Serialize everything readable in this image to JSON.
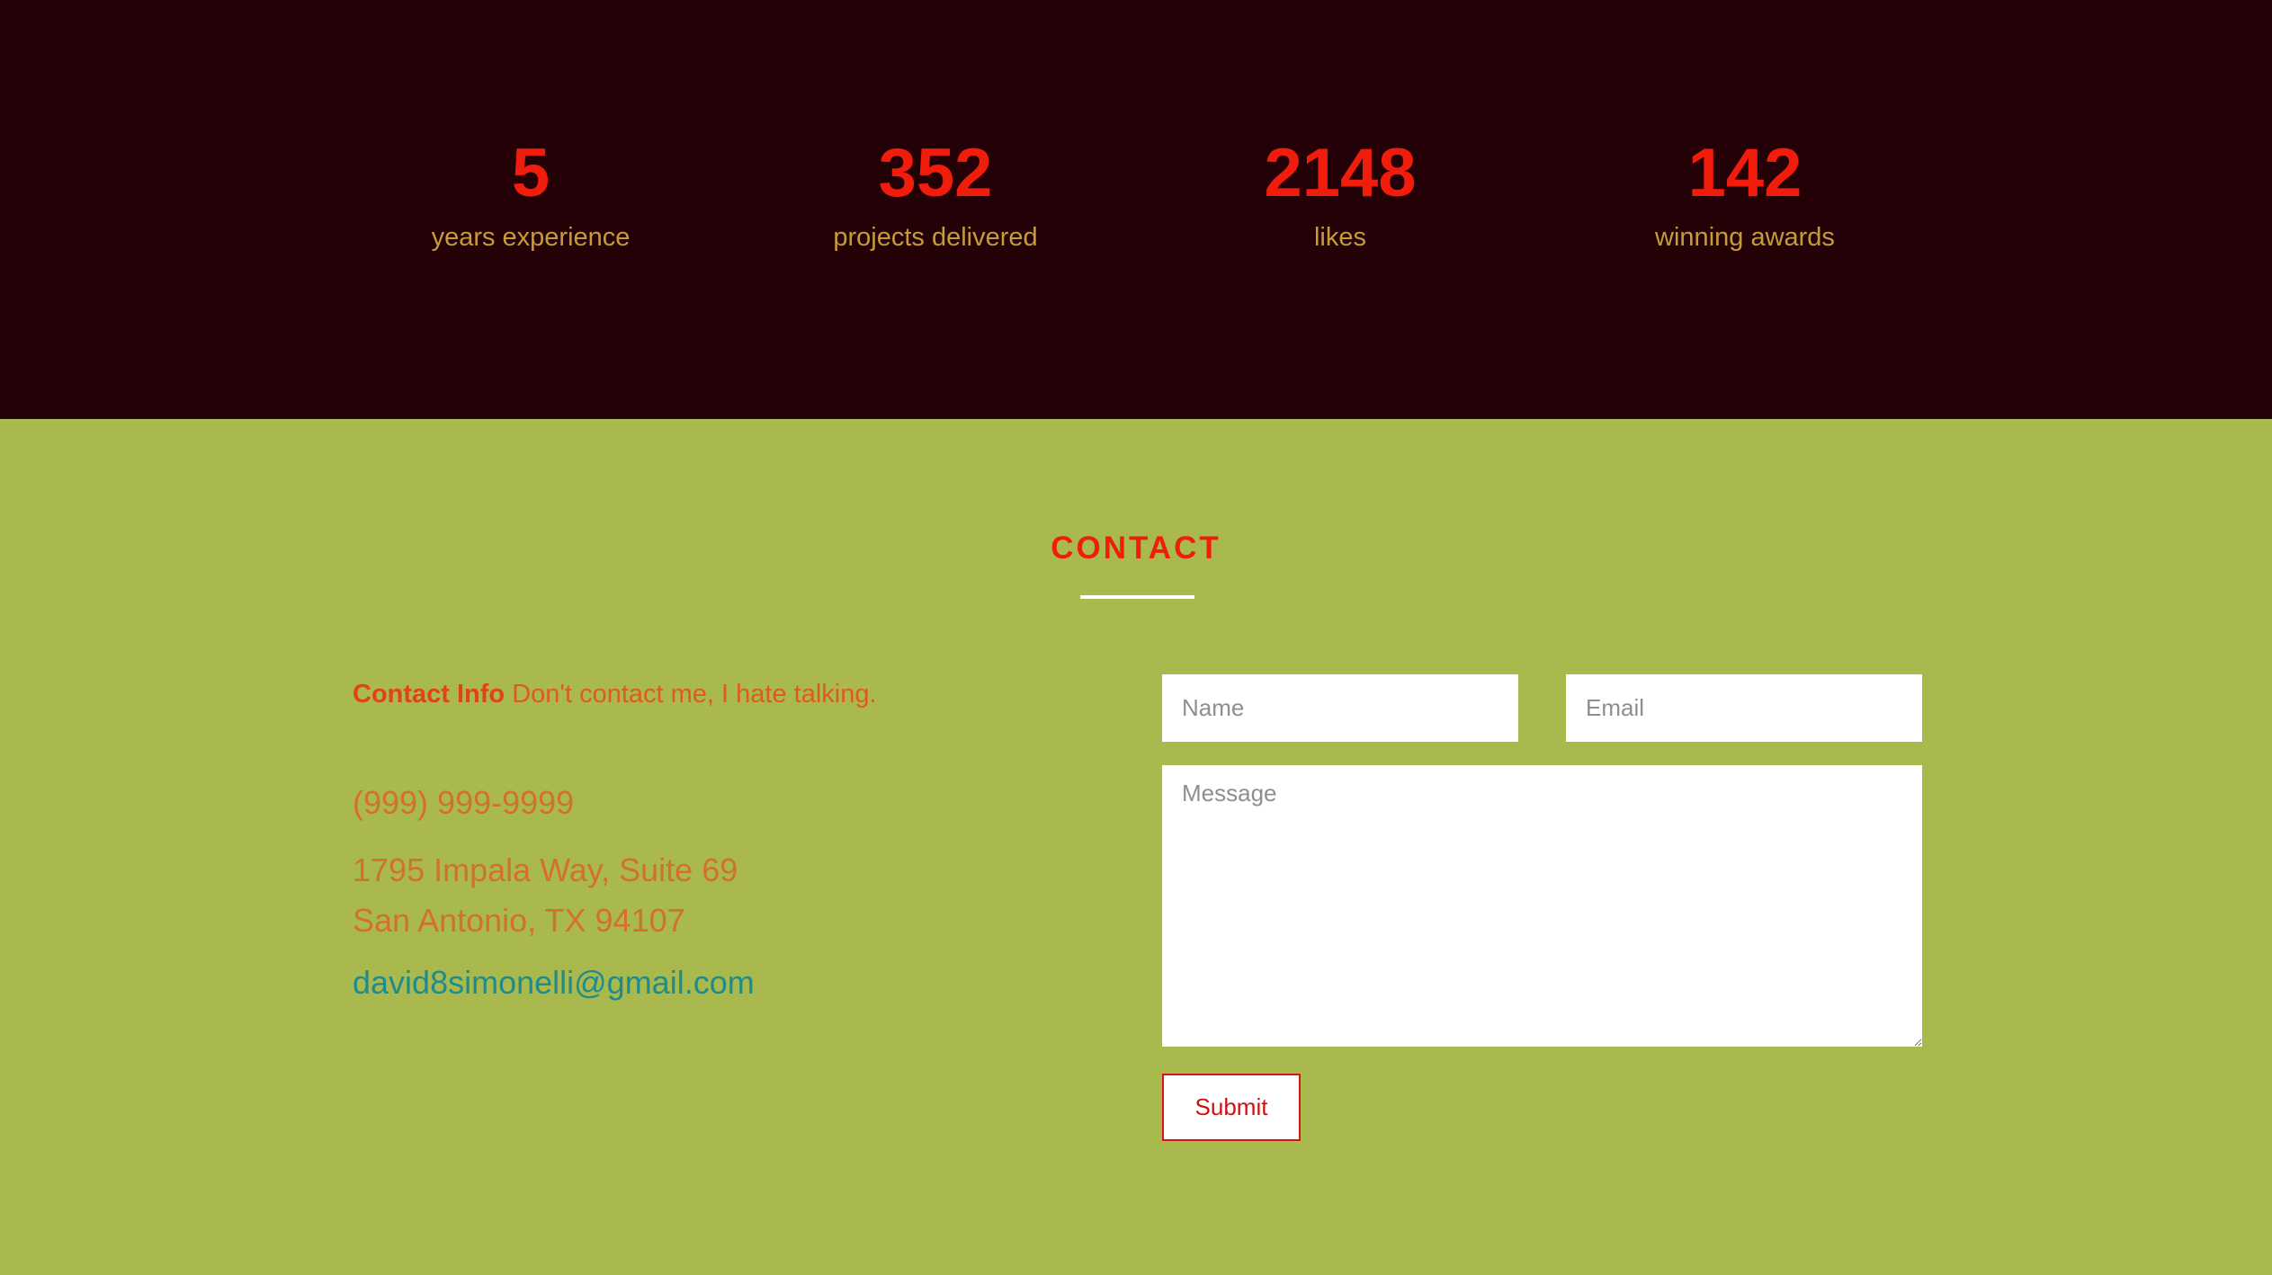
{
  "stats": [
    {
      "number": "5",
      "label": "years experience"
    },
    {
      "number": "352",
      "label": "projects delivered"
    },
    {
      "number": "2148",
      "label": "likes"
    },
    {
      "number": "142",
      "label": "winning awards"
    }
  ],
  "contact": {
    "title": "CONTACT",
    "info_label": "Contact Info",
    "info_text": "Don't contact me, I hate talking.",
    "phone": "(999) 999-9999",
    "address_line1": "1795 Impala Way, Suite 69",
    "address_line2": "San Antonio, TX 94107",
    "email": "david8simonelli@gmail.com"
  },
  "form": {
    "name_placeholder": "Name",
    "email_placeholder": "Email",
    "message_placeholder": "Message",
    "submit_label": "Submit"
  },
  "colors": {
    "stats_background": "#240107",
    "contact_background": "#a9b94d",
    "accent_red": "#f11d0c",
    "stat_label": "#c89a3a",
    "email_link": "#1f8c8c"
  }
}
